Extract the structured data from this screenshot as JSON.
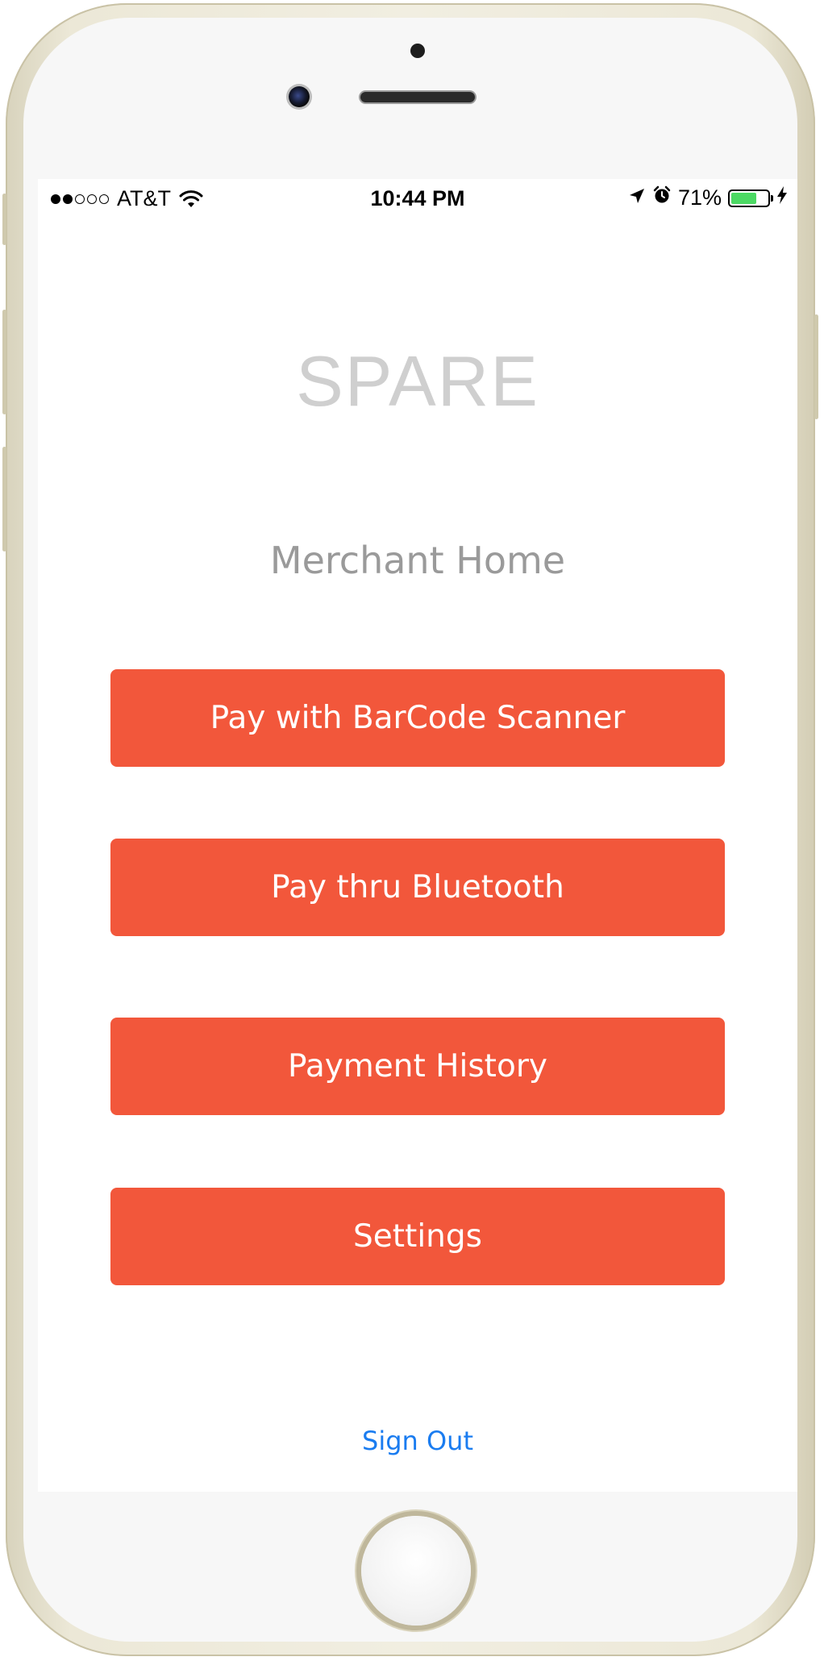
{
  "status_bar": {
    "carrier": "AT&T",
    "signal_bars_filled": 2,
    "signal_bars_total": 5,
    "time": "10:44 PM",
    "battery_percent_text": "71%",
    "battery_level": 0.71,
    "icons": [
      "wifi-icon",
      "location-arrow-icon",
      "alarm-clock-icon",
      "battery-icon",
      "charging-bolt-icon"
    ]
  },
  "app": {
    "title": "SPARE",
    "page_title": "Merchant Home"
  },
  "buttons": {
    "barcode": "Pay with BarCode Scanner",
    "bluetooth": "Pay thru Bluetooth",
    "history": "Payment History",
    "settings": "Settings"
  },
  "sign_out": "Sign Out",
  "colors": {
    "accent_button": "#f2573b",
    "link": "#1a7cf0",
    "title_gray": "#cfcfcf",
    "subtitle_gray": "#9a9a9a",
    "battery_green": "#4cd964"
  }
}
